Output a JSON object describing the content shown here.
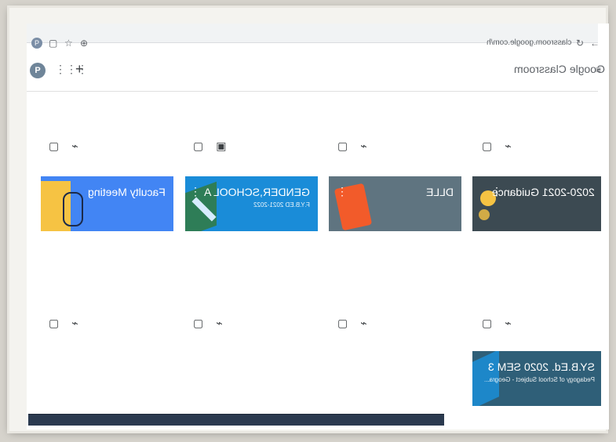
{
  "browser": {
    "url": "classroom.google.com/h",
    "profile_initial": "P"
  },
  "app": {
    "brand": "Google Classroom",
    "avatar_initial": "P",
    "add_label": "+"
  },
  "row1": [
    {
      "title": "Faculty Meeting",
      "subtitle": "",
      "color": "#4285f4"
    },
    {
      "title": "GENDER,SCHOOL A",
      "subtitle": "F.Y.B.ED 2021-2022",
      "color": "#1a8cd8"
    },
    {
      "title": "DLLE",
      "subtitle": "",
      "color": "#5f7480"
    },
    {
      "title": "2020-2021 Guidance",
      "subtitle": "",
      "color": "#3c4a52"
    }
  ],
  "row2": [
    {
      "title": "SY.B.Ed. 2020 SEM 3",
      "subtitle": "Pedagogy of School Subject - Geogra...",
      "color": "#2f5f78"
    }
  ]
}
